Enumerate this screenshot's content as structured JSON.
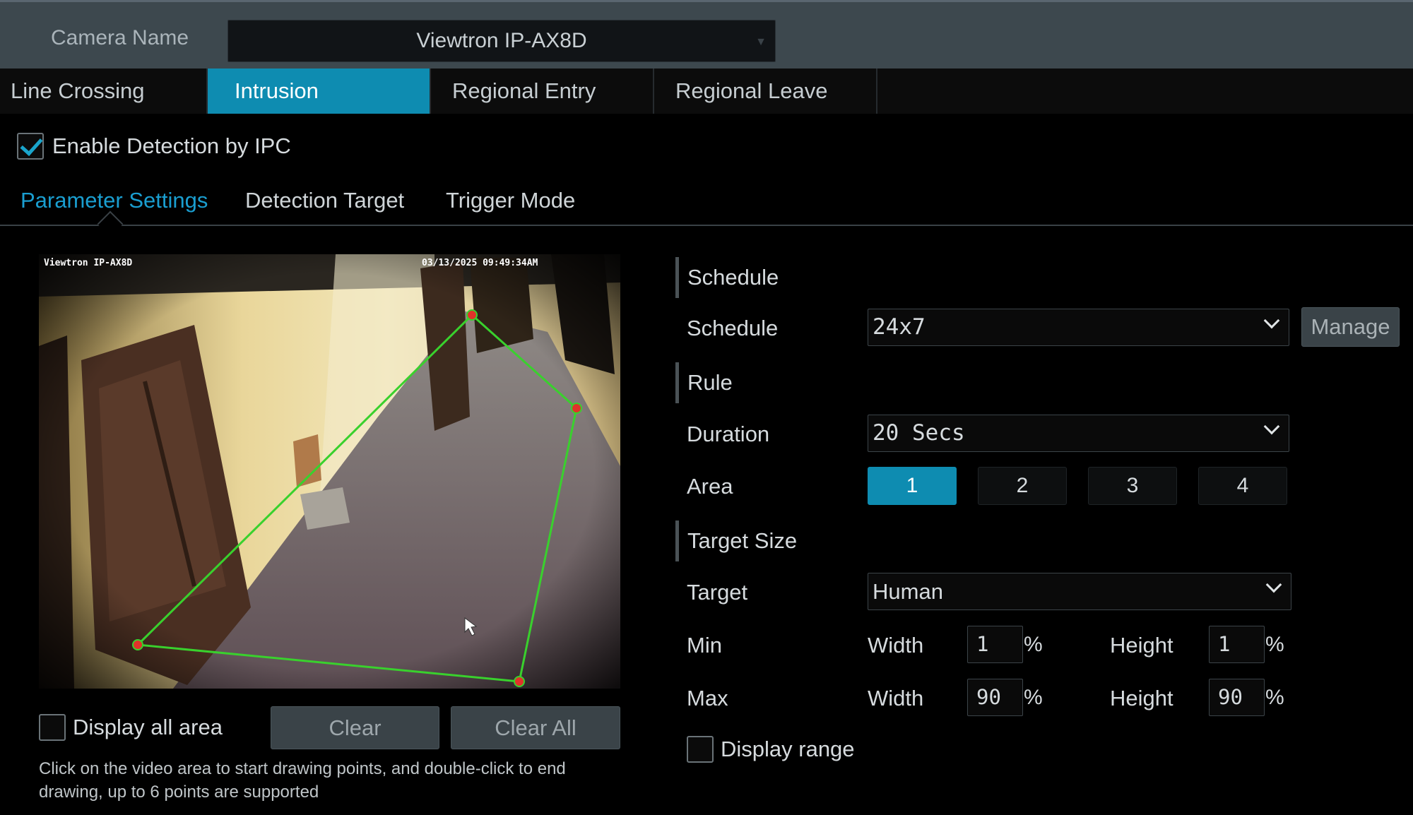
{
  "camera": {
    "label": "Camera Name",
    "value": "Viewtron IP-AX8D"
  },
  "tabs": [
    {
      "label": "Line Crossing"
    },
    {
      "label": "Intrusion"
    },
    {
      "label": "Regional Entry"
    },
    {
      "label": "Regional Leave"
    }
  ],
  "active_tab": "Intrusion",
  "enable_detection": {
    "label": "Enable Detection by IPC",
    "checked": true
  },
  "subtabs": [
    {
      "label": "Parameter Settings"
    },
    {
      "label": "Detection Target"
    },
    {
      "label": "Trigger Mode"
    }
  ],
  "active_subtab": "Parameter Settings",
  "video": {
    "camera_overlay": "Viewtron IP-AX8D",
    "timestamp": "03/13/2025 09:49:34AM",
    "zone_color": "#39d12d",
    "point_color": "#e0332a"
  },
  "drawing": {
    "display_all_area": {
      "label": "Display all area",
      "checked": false
    },
    "clear_label": "Clear",
    "clear_all_label": "Clear All",
    "hint": "Click on the video area to start drawing points, and double-click to end drawing, up to 6 points are supported"
  },
  "schedule": {
    "section": "Schedule",
    "label": "Schedule",
    "value": "24x7",
    "manage_label": "Manage"
  },
  "rule": {
    "section": "Rule",
    "duration_label": "Duration",
    "duration_value": "20 Secs",
    "area_label": "Area",
    "areas": [
      "1",
      "2",
      "3",
      "4"
    ],
    "active_area": "1"
  },
  "target_size": {
    "section": "Target Size",
    "target_label": "Target",
    "target_value": "Human",
    "min_label": "Min",
    "max_label": "Max",
    "width_label": "Width",
    "height_label": "Height",
    "unit": "%",
    "min_width": "1",
    "min_height": "1",
    "max_width": "90",
    "max_height": "90",
    "display_range": {
      "label": "Display range",
      "checked": false
    }
  },
  "colors": {
    "accent": "#0e8cb1",
    "accent_text": "#1a9ed0",
    "topbar": "#3d484e"
  }
}
